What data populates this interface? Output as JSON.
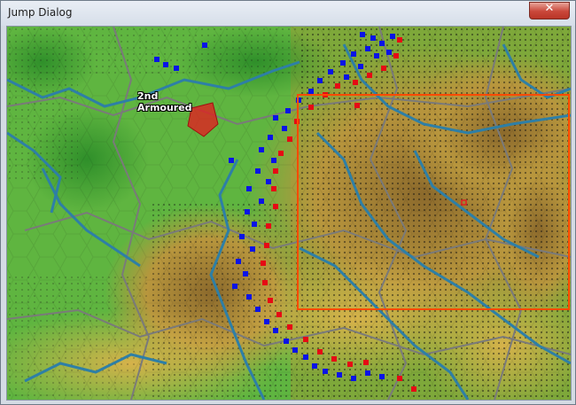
{
  "window": {
    "title": "Jump Dialog",
    "close_glyph": "✕"
  },
  "map": {
    "unit_label_line1": "2nd",
    "unit_label_line2": "Armoured",
    "colors": {
      "allied": "#0a14e6",
      "axis": "#e60a14",
      "viewport": "#ff4a00",
      "lowland": "#59b53c",
      "highland": "#b0913a",
      "river": "#2e7fa6"
    }
  }
}
